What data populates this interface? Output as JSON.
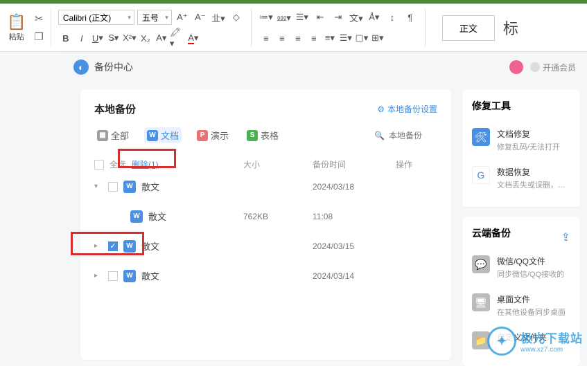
{
  "ribbon": {
    "paste_label": "粘贴",
    "font_name": "Calibri (正文)",
    "font_size": "五号",
    "style_label": "正文",
    "heading_label": "标"
  },
  "panel": {
    "title": "备份中心",
    "vip": "开通会员"
  },
  "local": {
    "title": "本地备份",
    "settings": "本地备份设置",
    "tabs": {
      "all": "全部",
      "doc": "文档",
      "ppt": "演示",
      "xls": "表格"
    },
    "search_placeholder": "本地备份",
    "select_all": "全选",
    "delete_label": "删除(1)",
    "col_size": "大小",
    "col_date": "备份时间",
    "col_op": "操作",
    "rows": [
      {
        "name": "散文",
        "date": "2024/03/18",
        "size": "",
        "expanded": true,
        "checked": false
      },
      {
        "name": "散文",
        "date": "",
        "size": "762KB",
        "time": "11:08",
        "child": true
      },
      {
        "name": "散文",
        "date": "2024/03/15",
        "size": "",
        "checked": true
      },
      {
        "name": "散文",
        "date": "2024/03/14",
        "size": "",
        "checked": false
      }
    ]
  },
  "repair": {
    "title": "修复工具",
    "doc_fix": "文档修复",
    "doc_fix_sub": "修复乱码/无法打开",
    "data_rec": "数据恢复",
    "data_rec_sub": "文档丢失或误删，…"
  },
  "cloud": {
    "title": "云端备份",
    "wechat": "微信/QQ文件",
    "wechat_sub": "同步微信/QQ接收的",
    "desktop": "桌面文件",
    "desktop_sub": "在其他设备同步桌面",
    "custom": "自定义文件夹"
  },
  "watermark": {
    "text": "极光下载站",
    "url": "www.xz7.com"
  }
}
